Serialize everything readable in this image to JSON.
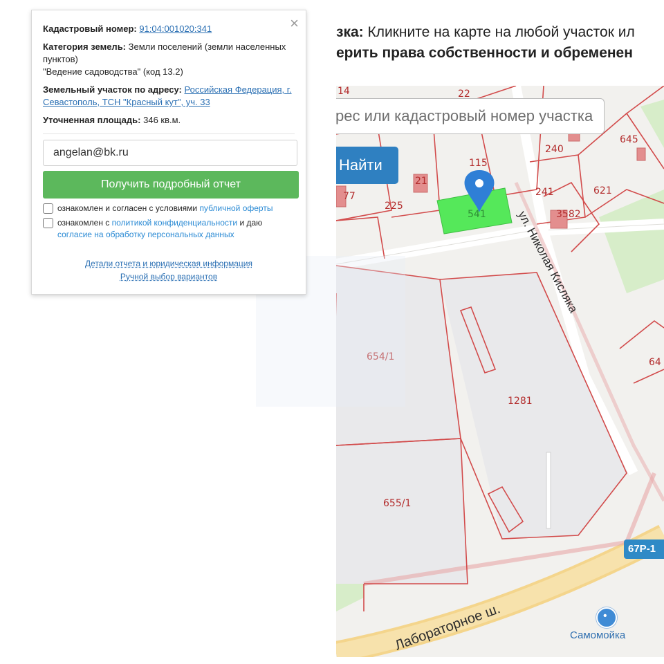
{
  "page_header": {
    "line1_bold": "зка:",
    "line1_rest": " Кликните на карте на любой участок ил",
    "line2": "ерить права собственности и обременен"
  },
  "map": {
    "search_placeholder": "рес или кадастровый номер участка",
    "find_button": "Найти",
    "parcel_labels": [
      "22",
      "240",
      "115",
      "21",
      "77",
      "225",
      "621",
      "645",
      "241",
      "3582",
      "654/1",
      "1281",
      "655/1",
      "14",
      "64",
      "541"
    ],
    "street_name": "ул. Николая Кисляка",
    "road_name": "Лабораторное ш.",
    "highway_badge": "67Р-1",
    "poi": {
      "name": "Самомойка",
      "icon": "car-wash-icon"
    },
    "selected_parcel_color": "#55e85a",
    "boundary_color": "#d24b4b",
    "marker_color": "#2f7fd6"
  },
  "popup": {
    "close_glyph": "×",
    "cadastral_label": "Кадастровый номер:",
    "cadastral_value": "91:04:001020:341",
    "category_label": "Категория земель:",
    "category_value": "Земли поселений (земли населенных пунктов)",
    "category_note": "\"Ведение садоводства\" (код 13.2)",
    "address_label": "Земельный участок по адресу:",
    "address_value": "Российская Федерация, г. Севастополь, ТСН \"Красный кут\", уч. 33",
    "area_label": "Уточненная площадь:",
    "area_value": "346 кв.м.",
    "email_value": "angelan@bk.ru",
    "cta_label": "Получить подробный отчет",
    "consent1_text": "ознакомлен и согласен с условиями ",
    "consent1_link": "публичной оферты",
    "consent2_text": "ознакомлен с ",
    "consent2_link": "политикой конфиденциальности",
    "consent2_mid": " и даю ",
    "consent2_link2": "согласие на обработку персональных данных",
    "footer_link1": "Детали отчета и юридическая информация",
    "footer_link2": "Ручной выбор вариантов"
  }
}
